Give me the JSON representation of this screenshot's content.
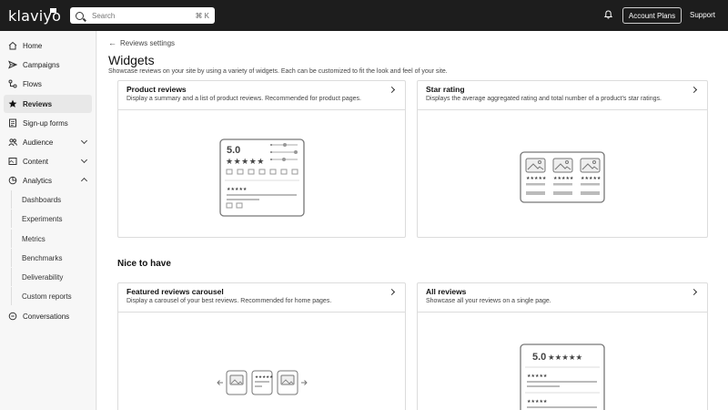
{
  "brand": {
    "logo_text": "klaviyo"
  },
  "topbar": {
    "search_placeholder": "Search",
    "search_shortcut": "⌘ K",
    "account_plans_label": "Account Plans",
    "support_label": "Support"
  },
  "sidebar": {
    "items": [
      {
        "label": "Home",
        "icon": "home-icon"
      },
      {
        "label": "Campaigns",
        "icon": "send-icon"
      },
      {
        "label": "Flows",
        "icon": "flow-icon"
      },
      {
        "label": "Reviews",
        "icon": "star-icon",
        "active": true
      },
      {
        "label": "Sign-up forms",
        "icon": "form-icon"
      },
      {
        "label": "Audience",
        "icon": "people-icon",
        "expandable": true
      },
      {
        "label": "Content",
        "icon": "content-icon",
        "expandable": true
      },
      {
        "label": "Analytics",
        "icon": "analytics-icon",
        "expanded": true
      },
      {
        "label": "Conversations",
        "icon": "chat-icon"
      }
    ],
    "analytics_sub": [
      "Dashboards",
      "Experiments",
      "Metrics",
      "Benchmarks",
      "Deliverability",
      "Custom reports"
    ]
  },
  "main": {
    "back_link": "Reviews settings",
    "title": "Widgets",
    "subtitle": "Showcase reviews on your site by using a variety of widgets. Each can be customized to fit the look and feel of your site.",
    "section_nice": "Nice to have",
    "cards": [
      {
        "title": "Product reviews",
        "desc": "Display a summary and a list of product reviews. Recommended for product pages.",
        "illus_rating": "5.0",
        "illus_stars": "★★★★★",
        "illus_small_stars": "★★★★★"
      },
      {
        "title": "Star rating",
        "desc": "Displays the average aggregated rating and total number of a product's star ratings.",
        "illus_stars": "★★★★★"
      },
      {
        "title": "Featured reviews carousel",
        "desc": "Display a carousel of your best reviews. Recommended for home pages.",
        "illus_stars": "★★★★★"
      },
      {
        "title": "All reviews",
        "desc": "Showcase all your reviews on a single page.",
        "illus_rating": "5.0",
        "illus_stars": "★★★★★",
        "illus_small_stars": "★★★★★"
      }
    ]
  }
}
